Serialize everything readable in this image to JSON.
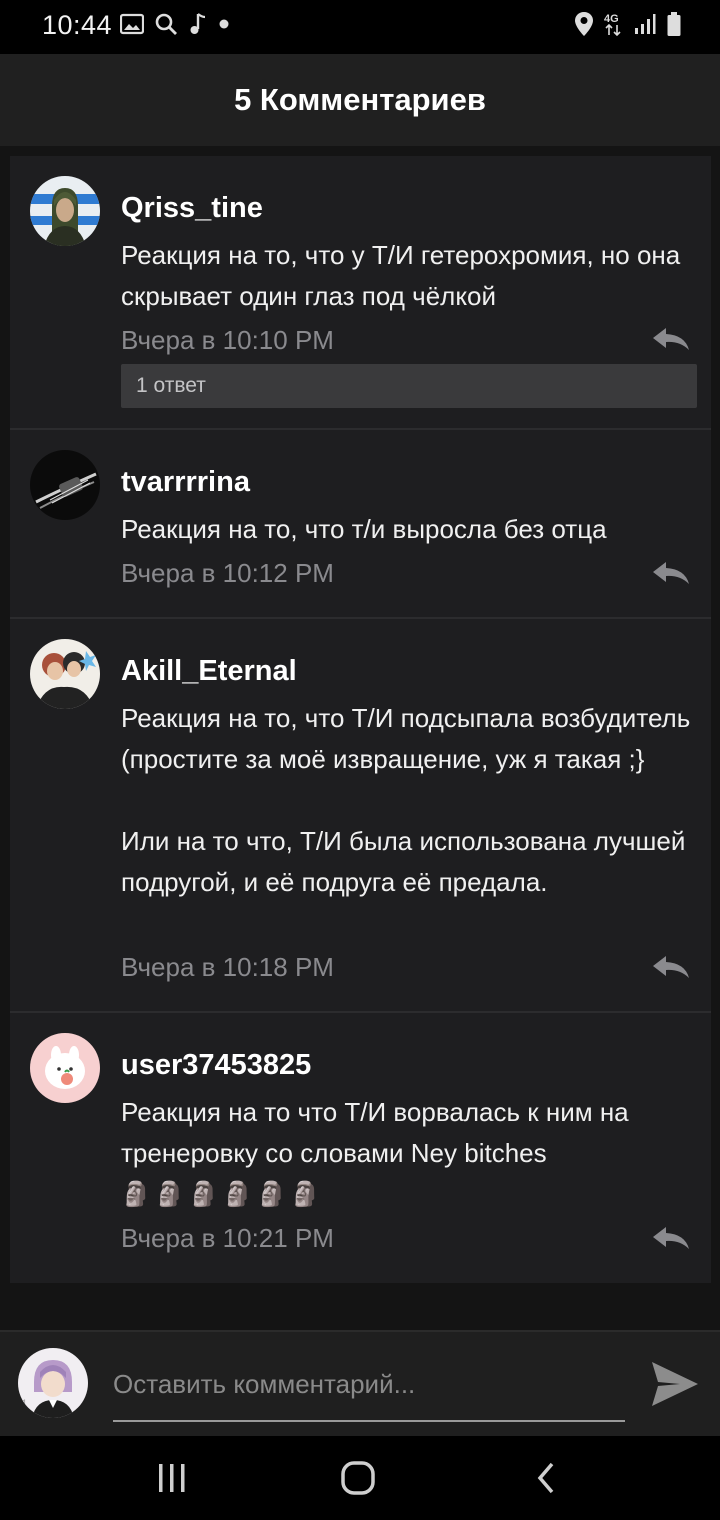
{
  "status_bar": {
    "time": "10:44",
    "left_icons": [
      "gallery-icon",
      "search-icon",
      "music-note-icon",
      "dot-icon"
    ],
    "right_icons": [
      "location-icon",
      "4g-icon",
      "signal-icon",
      "battery-icon"
    ],
    "network": "4G"
  },
  "header": {
    "title": "5 Комментариев"
  },
  "comments": [
    {
      "username": "Qriss_tine",
      "text": "Реакция на то, что у Т/И гетерохромия, но она скрывает один глаз под чёлкой",
      "time": "Вчера в 10:10 PM",
      "replies_label": "1 ответ"
    },
    {
      "username": "tvarrrrina",
      "text": "Реакция на то, что т/и выросла без отца",
      "time": "Вчера в 10:12 PM"
    },
    {
      "username": "Akill_Eternal",
      "text": "Реакция на то, что Т/И подсыпала возбудитель (простите за моё извращение, уж я такая ;}\n\nИли на то что, Т/И была использована лучшей подругой, и её подруга её предала.",
      "time": "Вчера в 10:18 PM"
    },
    {
      "username": "user37453825",
      "text": "Реакция на то что Т/И ворвалась к ним на тренеровку со словами Ney bitches",
      "emoji": "🗿🗿🗿🗿🗿🗿",
      "time": "Вчера в 10:21 PM"
    }
  ],
  "input": {
    "placeholder": "Оставить комментарий..."
  },
  "colors": {
    "background": "#141414",
    "panel": "#1e1e20",
    "header": "#202020",
    "muted_text": "#8a8a8e",
    "replies_bar": "#3a3a3c"
  }
}
